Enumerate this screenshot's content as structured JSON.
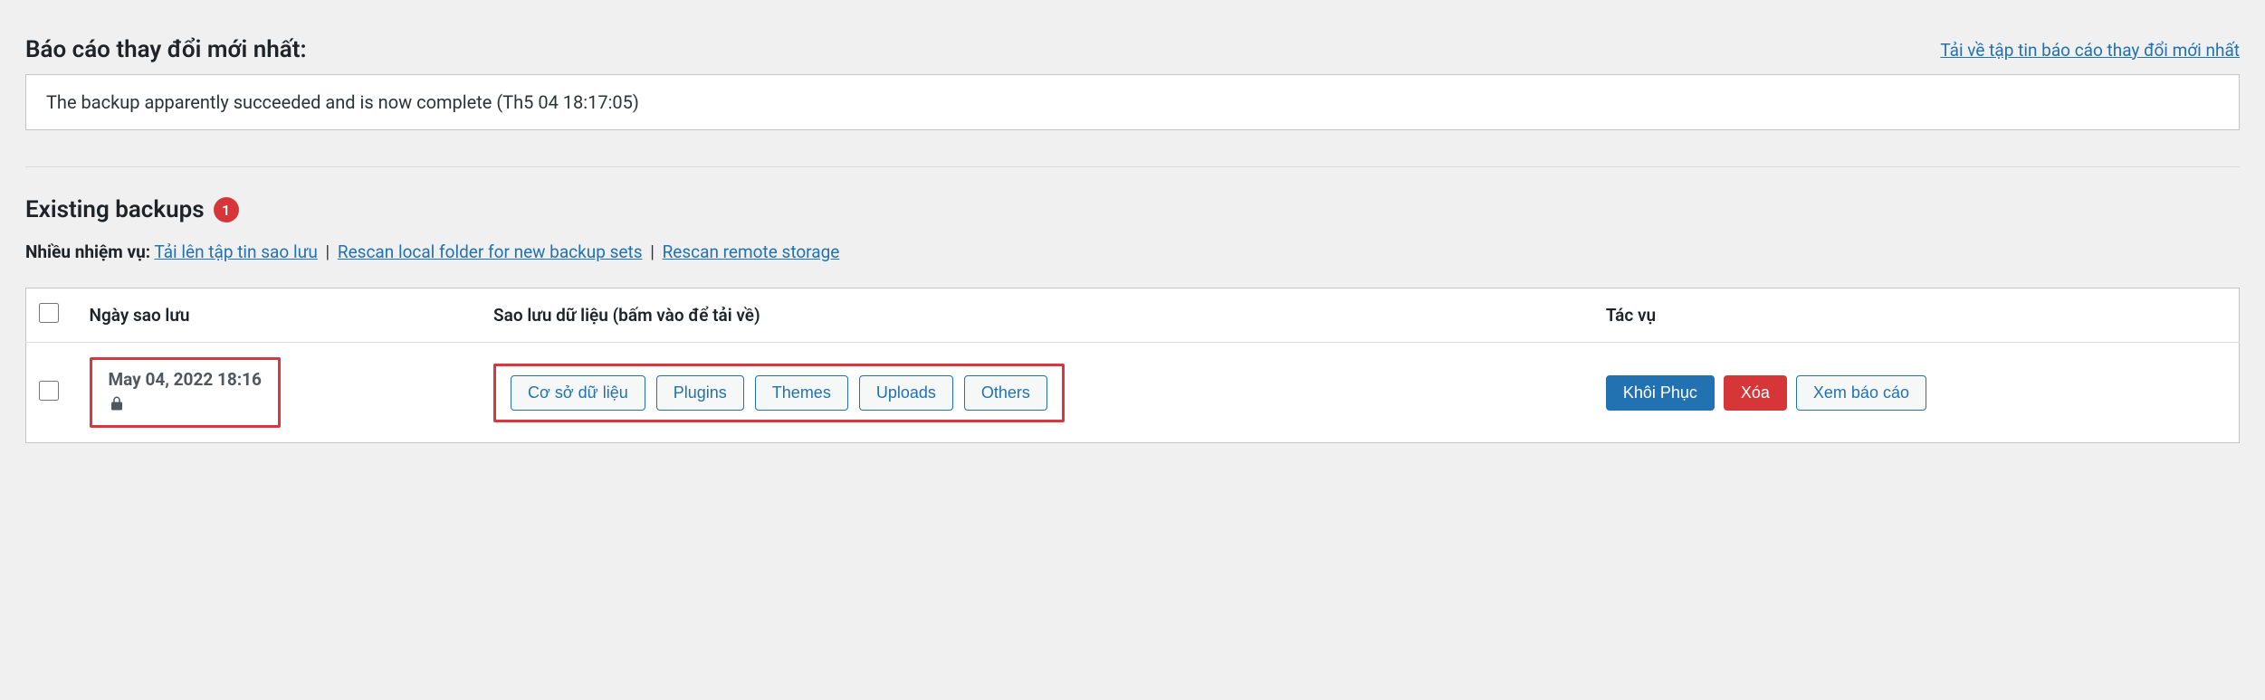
{
  "report": {
    "heading": "Báo cáo thay đổi mới nhất:",
    "download_link": "Tải về tập tin báo cáo thay đổi mới nhất",
    "log_message": "The backup apparently succeeded and is now complete (Th5 04 18:17:05)"
  },
  "existing": {
    "heading": "Existing backups",
    "count": "1",
    "tasks_label": "Nhiều nhiệm vụ:",
    "links": {
      "upload": "Tải lên tập tin sao lưu",
      "rescan_local": "Rescan local folder for new backup sets",
      "rescan_remote": "Rescan remote storage"
    }
  },
  "table": {
    "headers": {
      "date": "Ngày sao lưu",
      "data": "Sao lưu dữ liệu (bấm vào để tải về)",
      "actions": "Tác vụ"
    },
    "rows": [
      {
        "date": "May 04, 2022 18:16",
        "data_buttons": [
          "Cơ sở dữ liệu",
          "Plugins",
          "Themes",
          "Uploads",
          "Others"
        ],
        "actions": {
          "restore": "Khôi Phục",
          "delete": "Xóa",
          "view_log": "Xem báo cáo"
        }
      }
    ]
  }
}
